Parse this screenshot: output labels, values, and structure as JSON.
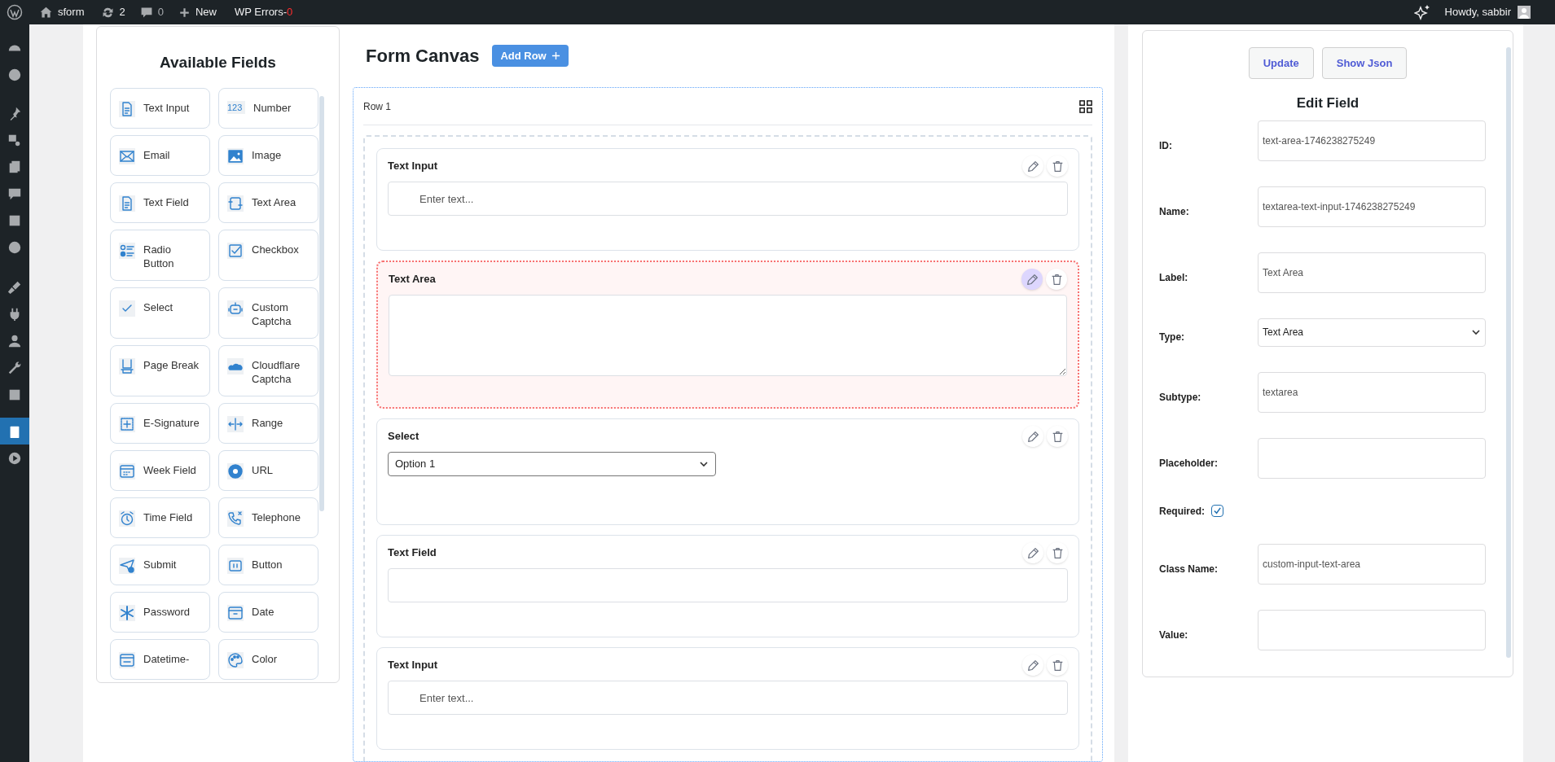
{
  "top_bar": {
    "site": "sform",
    "updates": "2",
    "comments": "0",
    "new": "New",
    "errors_label": "WP Errors-",
    "errors_count": "0",
    "greeting": "Howdy, sabbir"
  },
  "admin_menu": {
    "items": [
      {
        "selected": false
      },
      {
        "selected": false
      },
      {
        "selected": false
      },
      {
        "selected": false
      },
      {
        "selected": false
      },
      {
        "selected": false
      },
      {
        "selected": false
      },
      {
        "selected": false
      },
      {
        "selected": false
      },
      {
        "selected": false
      },
      {
        "selected": false
      },
      {
        "selected": false
      },
      {
        "selected": false
      },
      {
        "selected": true
      },
      {
        "selected": false
      }
    ]
  },
  "available_fields": {
    "title": "Available Fields",
    "items": [
      {
        "label": "Text Input"
      },
      {
        "label": "Number",
        "icon_text": "123"
      },
      {
        "label": "Email"
      },
      {
        "label": "Image"
      },
      {
        "label": "Text Field"
      },
      {
        "label": "Text Area"
      },
      {
        "label": "Radio Button"
      },
      {
        "label": "Checkbox"
      },
      {
        "label": "Select"
      },
      {
        "label": "Custom Captcha"
      },
      {
        "label": "Page Break"
      },
      {
        "label": "Cloudflare Captcha"
      },
      {
        "label": "E-Signature"
      },
      {
        "label": "Range"
      },
      {
        "label": "Week Field"
      },
      {
        "label": "URL"
      },
      {
        "label": "Time Field"
      },
      {
        "label": "Telephone"
      },
      {
        "label": "Submit"
      },
      {
        "label": "Button"
      },
      {
        "label": "Password"
      },
      {
        "label": "Date"
      },
      {
        "label": "Datetime-"
      },
      {
        "label": "Color"
      }
    ]
  },
  "canvas": {
    "title": "Form Canvas",
    "add_row_button": "Add Row",
    "rows": [
      {
        "label": "Row 1",
        "fields": [
          {
            "kind": "text_input",
            "label": "Text Input",
            "placeholder": "Enter text...",
            "selected": false
          },
          {
            "kind": "textarea",
            "label": "Text Area",
            "selected": true
          },
          {
            "kind": "select",
            "label": "Select",
            "value": "Option 1",
            "selected": false
          },
          {
            "kind": "text_input",
            "label": "Text Field",
            "selected": false
          },
          {
            "kind": "text_input",
            "label": "Text Input",
            "placeholder": "Enter text...",
            "selected": false
          }
        ]
      }
    ]
  },
  "edit_panel": {
    "buttons": [
      "Update",
      "Show Json"
    ],
    "title": "Edit Field",
    "fields": [
      {
        "kind": "text",
        "label": "ID:",
        "value": "text-area-1746238275249"
      },
      {
        "kind": "text",
        "label": "Name:",
        "value": "textarea-text-input-1746238275249"
      },
      {
        "kind": "text",
        "label": "Label:",
        "value": "Text Area"
      },
      {
        "kind": "select",
        "label": "Type:",
        "value": "Text Area"
      },
      {
        "kind": "text",
        "label": "Subtype:",
        "value": "textarea"
      },
      {
        "kind": "text",
        "label": "Placeholder:"
      },
      {
        "kind": "checkbox",
        "label": "Required:",
        "checked": true
      },
      {
        "kind": "text",
        "label": "Class Name:",
        "value": "custom-input-text-area"
      },
      {
        "kind": "text",
        "label": "Value:"
      }
    ]
  }
}
